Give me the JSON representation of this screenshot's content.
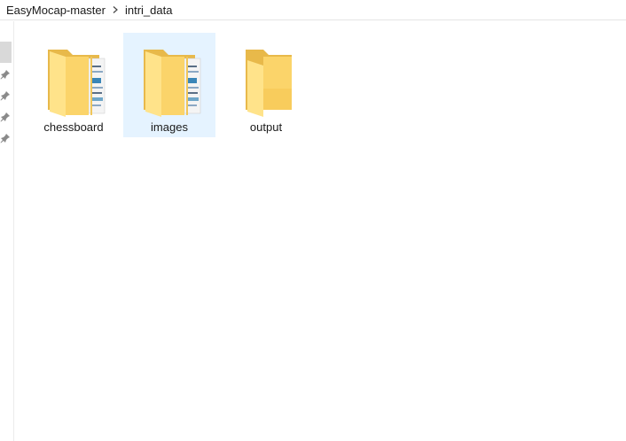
{
  "breadcrumb": {
    "items": [
      "EasyMocap-master",
      "intri_data"
    ]
  },
  "icons": {
    "separator": "chevron-right-icon",
    "pin": "pin-icon",
    "folder": "folder-icon"
  },
  "colors": {
    "selection_bg": "#e5f3ff",
    "folder_light": "#ffe38a",
    "folder_dark": "#e8b94a"
  },
  "folders": [
    {
      "label": "chessboard",
      "has_files": true,
      "selected": false
    },
    {
      "label": "images",
      "has_files": true,
      "selected": true
    },
    {
      "label": "output",
      "has_files": false,
      "selected": false
    }
  ]
}
